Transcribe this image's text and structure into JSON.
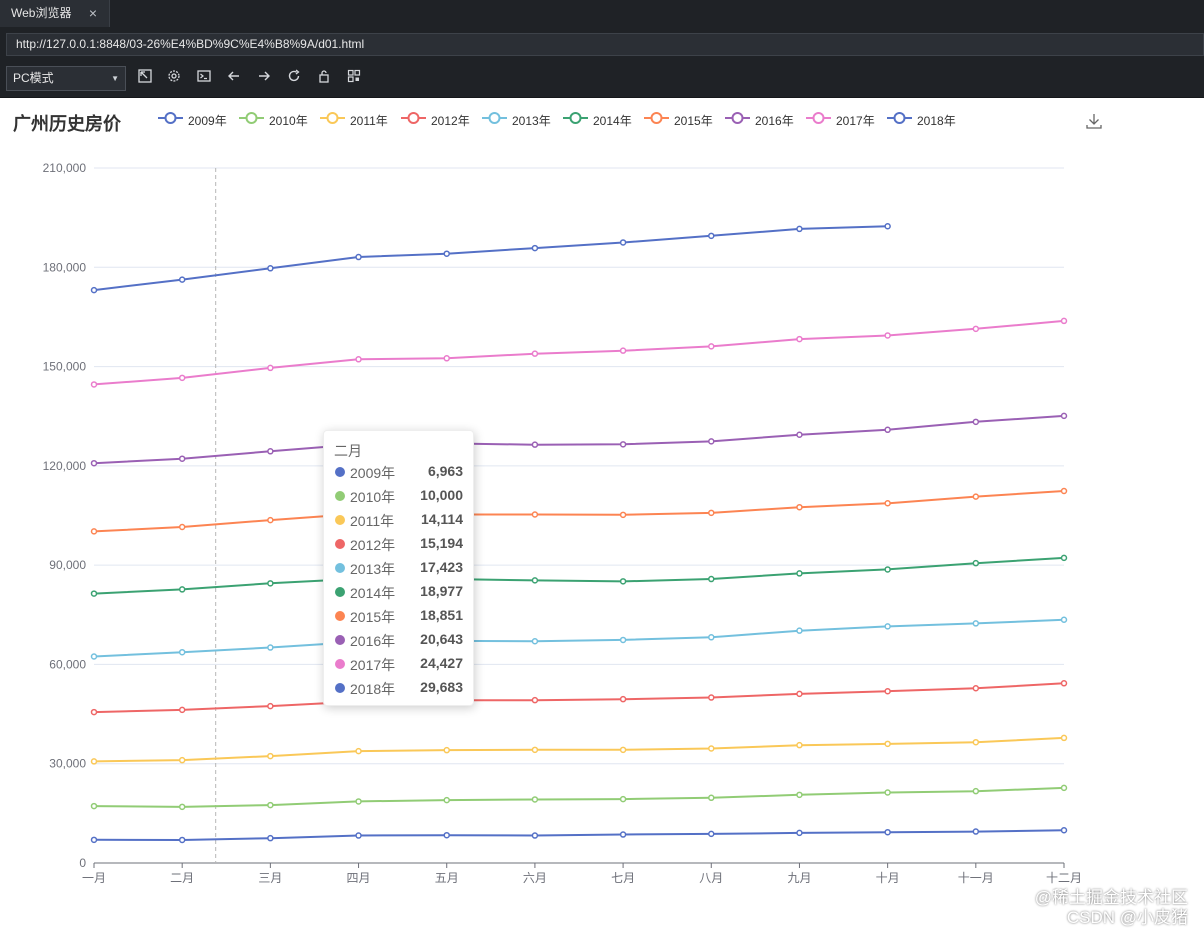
{
  "browser": {
    "tab_title": "Web浏览器",
    "tab_close": "×",
    "url": "http://127.0.0.1:8848/03-26%E4%BD%9C%E4%B8%9A/d01.html",
    "mode": "PC模式",
    "tools": [
      "expand-icon",
      "settings-icon",
      "console-icon",
      "back-icon",
      "forward-icon",
      "refresh-icon",
      "lock-icon",
      "qrcode-icon"
    ]
  },
  "watermark": {
    "line1": "@稀土掘金技术社区",
    "line2": "CSDN @小皮猪"
  },
  "chart_data": {
    "type": "line",
    "title": "广州历史房价",
    "categories": [
      "一月",
      "二月",
      "三月",
      "四月",
      "五月",
      "六月",
      "七月",
      "八月",
      "九月",
      "十月",
      "十一月",
      "十二月"
    ],
    "ylim": [
      0,
      210000
    ],
    "yticks": [
      0,
      30000,
      60000,
      90000,
      120000,
      150000,
      180000,
      210000
    ],
    "ytick_labels": [
      "0",
      "30,000",
      "60,000",
      "90,000",
      "120,000",
      "150,000",
      "180,000",
      "210,000"
    ],
    "grid": true,
    "stacked": true,
    "legend_position": "top",
    "series": [
      {
        "name": "2009年",
        "color": "#5470c6",
        "values": [
          7000,
          6963,
          7500,
          8300,
          8400,
          8300,
          8600,
          8800,
          9100,
          9300,
          9500,
          9900
        ]
      },
      {
        "name": "2010年",
        "color": "#91cc75",
        "values": [
          10200,
          10000,
          10000,
          10300,
          10600,
          10900,
          10700,
          10900,
          11500,
          12000,
          12200,
          12800
        ]
      },
      {
        "name": "2011年",
        "color": "#fac858",
        "values": [
          13500,
          14114,
          14800,
          15200,
          15100,
          15000,
          14900,
          14900,
          15000,
          14700,
          14800,
          15100
        ]
      },
      {
        "name": "2012年",
        "color": "#ee6666",
        "values": [
          14900,
          15194,
          15100,
          15000,
          15100,
          15000,
          15300,
          15400,
          15500,
          15900,
          16300,
          16500
        ]
      },
      {
        "name": "2013年",
        "color": "#73c0de",
        "values": [
          16800,
          17423,
          17700,
          18000,
          17900,
          17800,
          17900,
          18200,
          19100,
          19600,
          19600,
          19200
        ]
      },
      {
        "name": "2014年",
        "color": "#3ba272",
        "values": [
          19000,
          18977,
          19400,
          19100,
          18700,
          18400,
          17700,
          17600,
          17300,
          17200,
          18200,
          18700
        ]
      },
      {
        "name": "2015年",
        "color": "#fc8452",
        "values": [
          18800,
          18851,
          19100,
          19600,
          19500,
          19900,
          20100,
          20000,
          20000,
          20000,
          20100,
          20200
        ]
      },
      {
        "name": "2016年",
        "color": "#9a60b4",
        "values": [
          20600,
          20643,
          20800,
          21000,
          21500,
          21100,
          21300,
          21600,
          21900,
          22200,
          22600,
          22700
        ]
      },
      {
        "name": "2017年",
        "color": "#ea7ccc",
        "values": [
          23800,
          24427,
          25200,
          25700,
          25700,
          27500,
          28300,
          28700,
          28900,
          28500,
          28100,
          28700
        ]
      },
      {
        "name": "2018年",
        "color": "#5470c6",
        "values": [
          28500,
          29683,
          30100,
          30900,
          31600,
          31900,
          32700,
          33400,
          33300,
          33000,
          null,
          null
        ]
      }
    ],
    "axis_pointer": {
      "category": "二月"
    },
    "tooltip": {
      "title": "二月",
      "rows": [
        {
          "name": "2009年",
          "value": "6,963",
          "color": "#5470c6"
        },
        {
          "name": "2010年",
          "value": "10,000",
          "color": "#91cc75"
        },
        {
          "name": "2011年",
          "value": "14,114",
          "color": "#fac858"
        },
        {
          "name": "2012年",
          "value": "15,194",
          "color": "#ee6666"
        },
        {
          "name": "2013年",
          "value": "17,423",
          "color": "#73c0de"
        },
        {
          "name": "2014年",
          "value": "18,977",
          "color": "#3ba272"
        },
        {
          "name": "2015年",
          "value": "18,851",
          "color": "#fc8452"
        },
        {
          "name": "2016年",
          "value": "20,643",
          "color": "#9a60b4"
        },
        {
          "name": "2017年",
          "value": "24,427",
          "color": "#ea7ccc"
        },
        {
          "name": "2018年",
          "value": "29,683",
          "color": "#5470c6"
        }
      ]
    }
  }
}
